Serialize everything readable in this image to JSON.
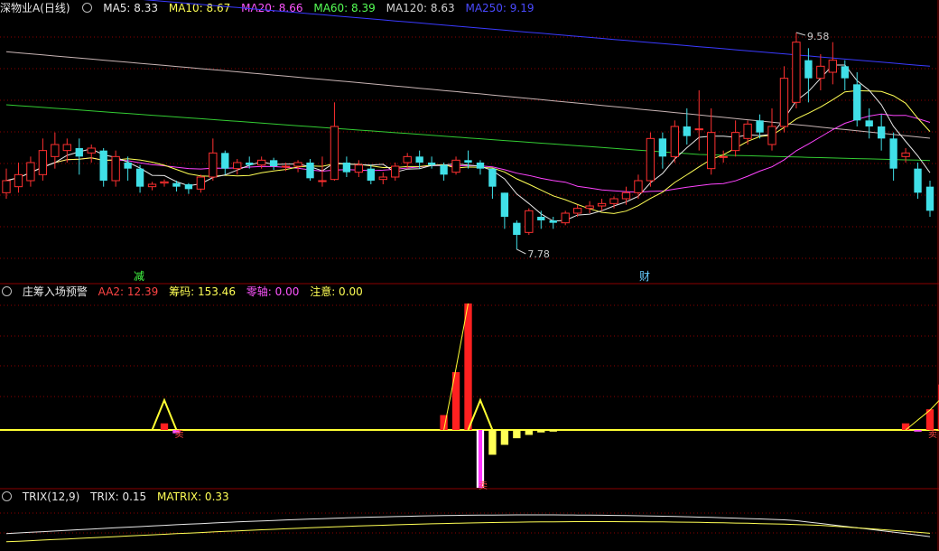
{
  "main_panel": {
    "title": "深物业A(日线)",
    "ma_labels": [
      {
        "text": "MA5: 8.33",
        "color": "#e8e8e8"
      },
      {
        "text": "MA10: 8.67",
        "color": "#ffff55"
      },
      {
        "text": "MA20: 8.66",
        "color": "#ff55ff"
      },
      {
        "text": "MA60: 8.39",
        "color": "#55ff55"
      },
      {
        "text": "MA120: 8.63",
        "color": "#d0d0d0"
      },
      {
        "text": "MA250: 9.19",
        "color": "#4a4aff"
      }
    ],
    "high_label": "9.58",
    "low_label": "7.78",
    "marker_reduce": "减",
    "marker_finance": "财"
  },
  "sub_panel": {
    "title": "庄筹入场预警",
    "labels": [
      {
        "text": "AA2: 12.39",
        "color": "#ff4444"
      },
      {
        "text": "筹码: 153.46",
        "color": "#ffff55"
      },
      {
        "text": "零轴: 0.00",
        "color": "#ff55ff"
      },
      {
        "text": "注意: 0.00",
        "color": "#ffff55"
      }
    ],
    "marker_sell": "卖"
  },
  "trix_panel": {
    "title": "TRIX(12,9)",
    "labels": [
      {
        "text": "TRIX: 0.15",
        "color": "#e8e8e8"
      },
      {
        "text": "MATRIX: 0.33",
        "color": "#ffff55"
      }
    ]
  },
  "colors": {
    "up": "#ff3030",
    "down": "#40e0e8",
    "bg": "#000000",
    "grid": "#8b0000"
  },
  "chart_data": {
    "type": "candlestick",
    "ylim": [
      7.6,
      9.7
    ],
    "candles": [
      [
        8.25,
        8.35,
        8.2,
        8.45
      ],
      [
        8.3,
        8.4,
        8.25,
        8.5
      ],
      [
        8.35,
        8.5,
        8.3,
        8.55
      ],
      [
        8.4,
        8.6,
        8.35,
        8.7
      ],
      [
        8.55,
        8.65,
        8.45,
        8.75
      ],
      [
        8.6,
        8.65,
        8.5,
        8.7
      ],
      [
        8.62,
        8.55,
        8.4,
        8.7
      ],
      [
        8.58,
        8.62,
        8.5,
        8.65
      ],
      [
        8.6,
        8.35,
        8.3,
        8.62
      ],
      [
        8.35,
        8.55,
        8.3,
        8.6
      ],
      [
        8.5,
        8.45,
        8.35,
        8.55
      ],
      [
        8.45,
        8.3,
        8.25,
        8.48
      ],
      [
        8.3,
        8.32,
        8.27,
        8.34
      ],
      [
        8.33,
        8.34,
        8.3,
        8.36
      ],
      [
        8.33,
        8.3,
        8.26,
        8.35
      ],
      [
        8.32,
        8.28,
        8.24,
        8.33
      ],
      [
        8.28,
        8.38,
        8.25,
        8.4
      ],
      [
        8.38,
        8.58,
        8.35,
        8.7
      ],
      [
        8.58,
        8.45,
        8.4,
        8.6
      ],
      [
        8.45,
        8.5,
        8.4,
        8.53
      ],
      [
        8.5,
        8.48,
        8.45,
        8.55
      ],
      [
        8.48,
        8.52,
        8.45,
        8.55
      ],
      [
        8.52,
        8.47,
        8.44,
        8.54
      ],
      [
        8.47,
        8.47,
        8.43,
        8.5
      ],
      [
        8.47,
        8.5,
        8.42,
        8.52
      ],
      [
        8.5,
        8.37,
        8.35,
        8.53
      ],
      [
        8.35,
        8.35,
        8.3,
        8.55
      ],
      [
        8.36,
        8.8,
        8.35,
        9.0
      ],
      [
        8.5,
        8.42,
        8.38,
        8.55
      ],
      [
        8.42,
        8.48,
        8.38,
        8.52
      ],
      [
        8.45,
        8.35,
        8.32,
        8.48
      ],
      [
        8.36,
        8.38,
        8.32,
        8.42
      ],
      [
        8.38,
        8.47,
        8.35,
        8.5
      ],
      [
        8.5,
        8.55,
        8.45,
        8.58
      ],
      [
        8.55,
        8.5,
        8.45,
        8.6
      ],
      [
        8.5,
        8.48,
        8.45,
        8.55
      ],
      [
        8.48,
        8.4,
        8.35,
        8.5
      ],
      [
        8.42,
        8.52,
        8.4,
        8.55
      ],
      [
        8.52,
        8.5,
        8.45,
        8.6
      ],
      [
        8.5,
        8.45,
        8.4,
        8.52
      ],
      [
        8.45,
        8.3,
        8.2,
        8.45
      ],
      [
        8.25,
        8.05,
        7.95,
        8.25
      ],
      [
        8.0,
        7.9,
        7.78,
        8.02
      ],
      [
        7.92,
        8.1,
        7.9,
        8.12
      ],
      [
        8.05,
        8.02,
        7.95,
        8.1
      ],
      [
        8.02,
        8.0,
        7.95,
        8.05
      ],
      [
        8.0,
        8.08,
        7.98,
        8.1
      ],
      [
        8.08,
        8.12,
        8.05,
        8.15
      ],
      [
        8.12,
        8.14,
        8.08,
        8.18
      ],
      [
        8.14,
        8.16,
        8.1,
        8.2
      ],
      [
        8.16,
        8.2,
        8.12,
        8.22
      ],
      [
        8.2,
        8.25,
        8.15,
        8.3
      ],
      [
        8.25,
        8.35,
        8.2,
        8.4
      ],
      [
        8.35,
        8.7,
        8.3,
        8.75
      ],
      [
        8.7,
        8.55,
        8.45,
        8.75
      ],
      [
        8.55,
        8.8,
        8.5,
        8.85
      ],
      [
        8.8,
        8.72,
        8.65,
        8.95
      ],
      [
        8.78,
        8.78,
        8.6,
        9.1
      ],
      [
        8.45,
        8.75,
        8.4,
        8.95
      ],
      [
        8.55,
        8.55,
        8.5,
        8.6
      ],
      [
        8.6,
        8.75,
        8.55,
        8.85
      ],
      [
        8.7,
        8.82,
        8.65,
        8.85
      ],
      [
        8.85,
        8.75,
        8.7,
        8.9
      ],
      [
        8.65,
        8.8,
        8.6,
        8.95
      ],
      [
        8.8,
        9.2,
        8.75,
        9.3
      ],
      [
        9.0,
        9.5,
        8.95,
        9.58
      ],
      [
        9.35,
        9.2,
        9.0,
        9.45
      ],
      [
        9.2,
        9.3,
        9.1,
        9.4
      ],
      [
        9.25,
        9.35,
        9.15,
        9.5
      ],
      [
        9.3,
        9.2,
        9.1,
        9.35
      ],
      [
        9.15,
        8.85,
        8.8,
        9.25
      ],
      [
        8.85,
        8.8,
        8.7,
        8.95
      ],
      [
        8.8,
        8.7,
        8.6,
        8.9
      ],
      [
        8.7,
        8.45,
        8.35,
        8.75
      ],
      [
        8.55,
        8.58,
        8.5,
        8.62
      ],
      [
        8.45,
        8.25,
        8.2,
        8.5
      ],
      [
        8.3,
        8.1,
        8.05,
        8.35
      ]
    ],
    "sub_bars": [
      {
        "i": 13,
        "v": 8,
        "c": "#ff2020"
      },
      {
        "i": 14,
        "v": -4,
        "c": "#ff55ff"
      },
      {
        "i": 36,
        "v": 18,
        "c": "#ff2020"
      },
      {
        "i": 37,
        "v": 70,
        "c": "#ff2020"
      },
      {
        "i": 38,
        "v": 153,
        "c": "#ff2020"
      },
      {
        "i": 39,
        "v": -70,
        "c": "#ffffff"
      },
      {
        "i": 40,
        "v": -30,
        "c": "#ffff55"
      },
      {
        "i": 41,
        "v": -18,
        "c": "#ffff55"
      },
      {
        "i": 42,
        "v": -10,
        "c": "#ffff55"
      },
      {
        "i": 43,
        "v": -6,
        "c": "#ffff55"
      },
      {
        "i": 44,
        "v": -3,
        "c": "#ffff55"
      },
      {
        "i": 45,
        "v": -2,
        "c": "#ffff55"
      },
      {
        "i": 74,
        "v": 8,
        "c": "#ff2020"
      },
      {
        "i": 75,
        "v": -2,
        "c": "#ff55ff"
      },
      {
        "i": 76,
        "v": 25,
        "c": "#ff2020"
      },
      {
        "i": 77,
        "v": 55,
        "c": "#ff2020"
      }
    ]
  }
}
